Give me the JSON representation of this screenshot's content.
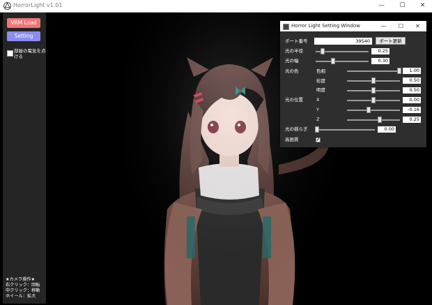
{
  "window": {
    "title": "HorrorLight v1.01",
    "minimize_icon": "minimize-icon",
    "maximize_icon": "maximize-icon",
    "close_icon": "close-icon",
    "minimize_glyph": "—",
    "maximize_glyph": "☐",
    "close_glyph": "✕"
  },
  "left_panel": {
    "vrm_load_label": "VRM Load",
    "setting_label": "Setting",
    "room_light_label": "部屋の電気を点ける",
    "room_light_checked": false,
    "help_lines": [
      "★カメラ操作★",
      "右クリック：回転",
      "中クリック：移動",
      "ホイール：拡大"
    ]
  },
  "settings_window": {
    "title": "Horror Light Setting Window",
    "port_label": "ポート番号",
    "port_value": "39540",
    "port_update_label": "ポート更新",
    "radius_label": "光の半径",
    "radius_value": "0.25",
    "width_label": "光の幅",
    "width_value": "0.30",
    "color_label": "光の色",
    "hue_label": "色相",
    "hue_value": "1.00",
    "saturation_label": "彩度",
    "saturation_value": "0.50",
    "brightness_label": "明度",
    "brightness_value": "0.50",
    "position_label": "光の位置",
    "x_label": "X",
    "x_value": "0.00",
    "y_label": "Y",
    "y_value": "-0.16",
    "z_label": "Z",
    "z_value": "0.25",
    "flicker_label": "光の揺らぎ",
    "flicker_value": "0.00",
    "hq_label": "高画質",
    "hq_checked": true,
    "check_glyph": "✔"
  },
  "colors": {
    "vrm_button": "#f07676",
    "setting_button": "#8c8cf2",
    "panel_bg": "#2e2e2e",
    "background": "#000000"
  }
}
